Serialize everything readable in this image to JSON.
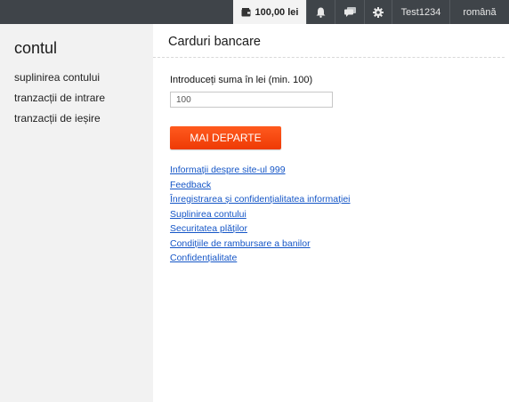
{
  "topbar": {
    "balance": "100,00 lei",
    "username": "Test1234",
    "language": "română",
    "icons": [
      "wallet-icon",
      "bell-icon",
      "chat-icon",
      "gear-icon"
    ]
  },
  "sidebar": {
    "title": "contul",
    "items": [
      {
        "label": "suplinirea contului"
      },
      {
        "label": "tranzacții de intrare"
      },
      {
        "label": "tranzacții de ieșire"
      }
    ]
  },
  "main": {
    "title": "Carduri bancare",
    "amount_label": "Introduceți suma în lei (min. 100)",
    "amount_value": "100",
    "next_button": "MAI DEPARTE",
    "links": [
      "Informații despre site-ul 999",
      "Feedback",
      "Înregistrarea și confidențialitatea informației",
      "Suplinirea contului",
      "Securitatea plăților",
      "Condițiile de rambursare a banilor",
      "Confidențialitate"
    ]
  },
  "colors": {
    "topbar_bg": "#3f4449",
    "sidebar_bg": "#f2f2f2",
    "button_accent": "#f24a0f",
    "link_color": "#1556c7"
  }
}
